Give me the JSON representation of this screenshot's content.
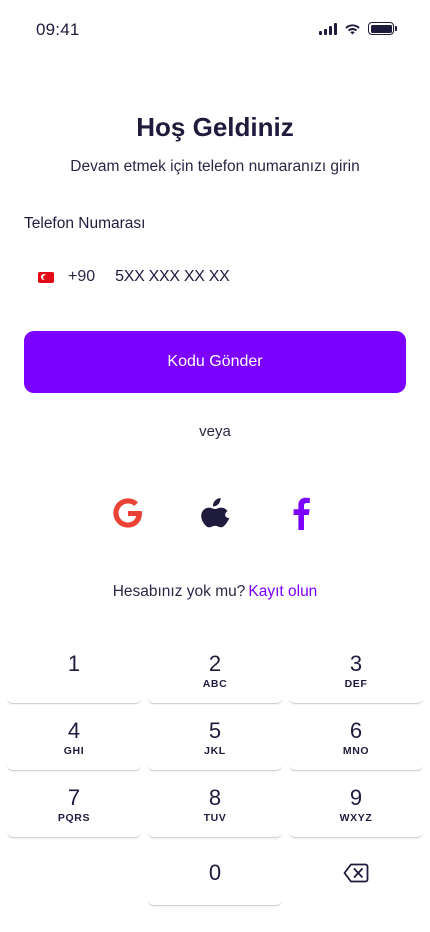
{
  "status_bar": {
    "time": "09:41"
  },
  "header": {
    "title": "Hoş Geldiniz",
    "subtitle": "Devam etmek için telefon numaranızı girin"
  },
  "phone": {
    "label": "Telefon Numarası",
    "country_code": "+90",
    "placeholder": "5XX XXX XX XX",
    "flag_icon": "turkey-flag-icon"
  },
  "send_button": {
    "label": "Kodu Gönder"
  },
  "divider": {
    "text": "veya"
  },
  "social": {
    "google_icon": "google-icon",
    "apple_icon": "apple-icon",
    "facebook_icon": "facebook-icon"
  },
  "signup": {
    "prompt": "Hesabınız yok mu?",
    "link": "Kayıt olun"
  },
  "keypad": {
    "k1": {
      "num": "1",
      "letters": ""
    },
    "k2": {
      "num": "2",
      "letters": "ABC"
    },
    "k3": {
      "num": "3",
      "letters": "DEF"
    },
    "k4": {
      "num": "4",
      "letters": "GHI"
    },
    "k5": {
      "num": "5",
      "letters": "JKL"
    },
    "k6": {
      "num": "6",
      "letters": "MNO"
    },
    "k7": {
      "num": "7",
      "letters": "PQRS"
    },
    "k8": {
      "num": "8",
      "letters": "TUV"
    },
    "k9": {
      "num": "9",
      "letters": "WXYZ"
    },
    "k0": {
      "num": "0"
    },
    "backspace_icon": "backspace-icon"
  },
  "colors": {
    "accent": "#7b00ff",
    "text": "#1f1b3d",
    "google_red": "#ea4335"
  }
}
